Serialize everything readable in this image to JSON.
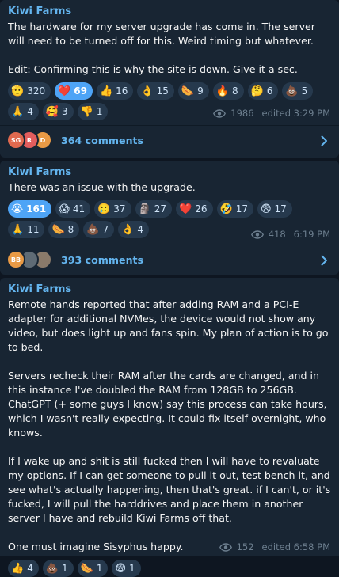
{
  "posts": [
    {
      "channel": "Kiwi Farms",
      "text": "The hardware for my server upgrade has come in. The server will need to be turned off for this. Weird timing but whatever.\n\nEdit: Confirming this is why the site is down. Give it a sec.",
      "reactions": [
        {
          "emoji": "🫡",
          "count": "320",
          "active": false
        },
        {
          "emoji": "❤️",
          "count": "69",
          "active": true
        },
        {
          "emoji": "👍",
          "count": "16",
          "active": false
        },
        {
          "emoji": "👌",
          "count": "15",
          "active": false
        },
        {
          "emoji": "🌭",
          "count": "9",
          "active": false
        },
        {
          "emoji": "🔥",
          "count": "8",
          "active": false
        },
        {
          "emoji": "🤔",
          "count": "6",
          "active": false
        },
        {
          "emoji": "💩",
          "count": "5",
          "active": false
        },
        {
          "emoji": "🙏",
          "count": "4",
          "active": false
        },
        {
          "emoji": "🥰",
          "count": "3",
          "active": false
        },
        {
          "emoji": "👎",
          "count": "1",
          "active": false
        }
      ],
      "views": "1986",
      "time": "edited 3:29 PM",
      "comments": {
        "label": "364 comments",
        "avatars": [
          {
            "initials": "SG",
            "color": "#e0694f"
          },
          {
            "initials": "R",
            "color": "#e35d5d"
          },
          {
            "initials": "D",
            "color": "#e99a45"
          }
        ]
      }
    },
    {
      "channel": "Kiwi Farms",
      "text": "There was an issue with the upgrade.",
      "reactions": [
        {
          "emoji": "😭",
          "count": "161",
          "active": true
        },
        {
          "emoji": "😱",
          "count": "41",
          "active": false
        },
        {
          "emoji": "🥲",
          "count": "37",
          "active": false
        },
        {
          "emoji": "🗿",
          "count": "27",
          "active": false
        },
        {
          "emoji": "❤️",
          "count": "26",
          "active": false
        },
        {
          "emoji": "🤣",
          "count": "17",
          "active": false
        },
        {
          "emoji": "😨",
          "count": "17",
          "active": false
        },
        {
          "emoji": "🙏",
          "count": "11",
          "active": false
        },
        {
          "emoji": "🌭",
          "count": "8",
          "active": false
        },
        {
          "emoji": "💩",
          "count": "7",
          "active": false
        },
        {
          "emoji": "👌",
          "count": "4",
          "active": false
        }
      ],
      "views": "418",
      "time": "6:19 PM",
      "comments": {
        "label": "393 comments",
        "avatars": [
          {
            "initials": "BB",
            "color": "#e99a45"
          },
          {
            "initials": "",
            "color": "#5f6b75"
          },
          {
            "initials": "",
            "color": "#8a7a6a"
          }
        ]
      }
    },
    {
      "channel": "Kiwi Farms",
      "text": "Remote hands reported that after adding RAM and a PCI-E adapter for additional NVMes, the device would not show any video, but does light up and fans spin. My plan of action is to go to bed.\n\nServers recheck their RAM after the cards are changed, and in this instance I've doubled the RAM from 128GB to 256GB. ChatGPT (+ some guys I know) say this process can take hours, which I wasn't really expecting. It could fix itself overnight, who knows.\n\nIf I wake up and shit is still fucked then I will have to revaluate my options. If I can get someone to pull it out, test bench it, and see what's actually happening, then that's great. if I can't, or it's fucked, I will pull the harddrives and place them in another server I have and rebuild Kiwi Farms off that.\n\nOne must imagine Sisyphus happy.",
      "reactions": [
        {
          "emoji": "👍",
          "count": "4",
          "active": false
        },
        {
          "emoji": "💩",
          "count": "1",
          "active": false
        },
        {
          "emoji": "🌭",
          "count": "1",
          "active": false
        },
        {
          "emoji": "😨",
          "count": "1",
          "active": false
        }
      ],
      "views": "152",
      "time": "edited 6:58 PM"
    }
  ],
  "colors": {
    "background": "#0e1621",
    "card": "#182533",
    "accent": "#64b5ef",
    "reaction": "#26394d",
    "reaction_active": "#4ea4f6",
    "meta": "#6d7f8f"
  },
  "icons": {
    "views": "eye-icon",
    "open_comments": "chevron-right-icon"
  }
}
